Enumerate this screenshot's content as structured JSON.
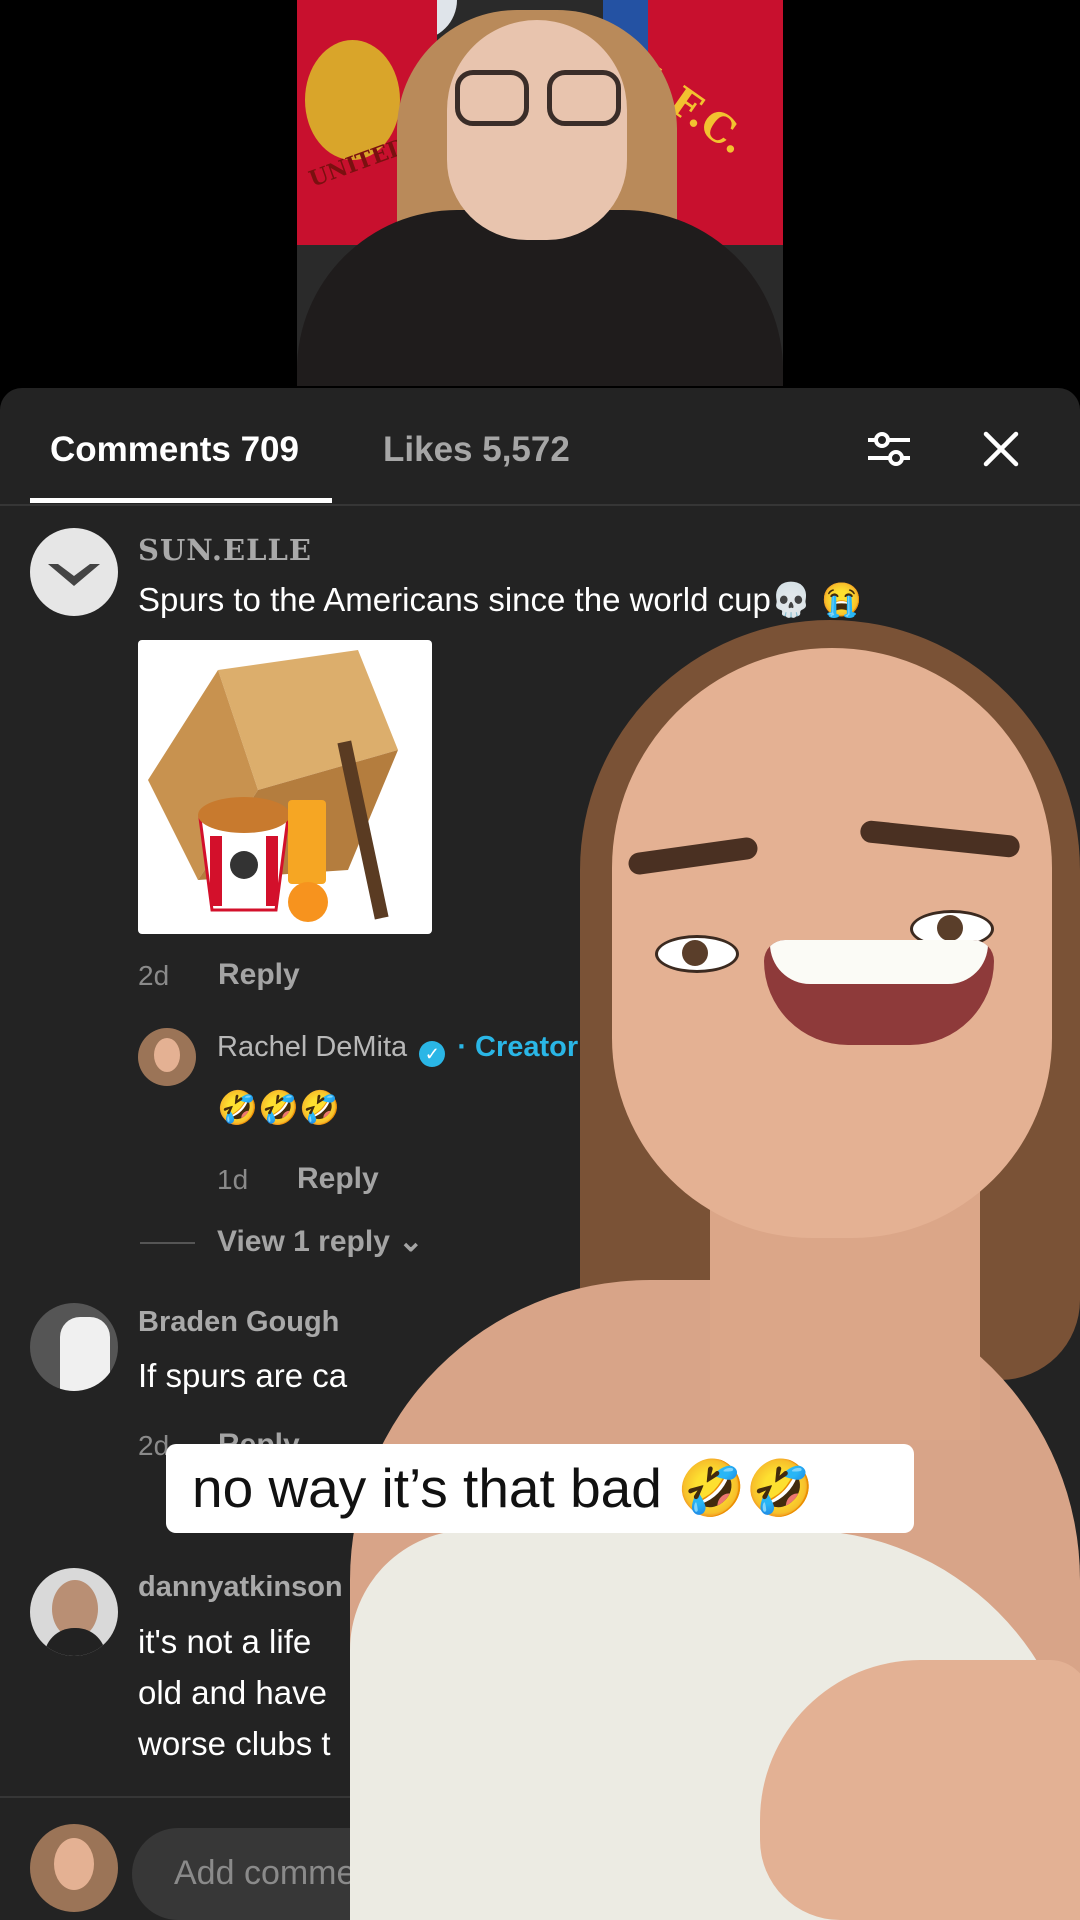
{
  "tabs": {
    "comments_label": "Comments 709",
    "likes_label": "Likes 5,572"
  },
  "icons": {
    "filter": "sliders-icon",
    "close": "close-icon"
  },
  "comments": [
    {
      "username": "SUN.ELLE",
      "text": "Spurs to the Americans since the world cup💀 😭",
      "age": "2d",
      "reply_label": "Reply",
      "image_description": "wooden box trap over fried chicken bucket and orange juice"
    },
    {
      "username": "Braden Gough",
      "text": "If spurs are ca",
      "age": "2d",
      "reply_label": "Reply"
    },
    {
      "username": "dannyatkinson",
      "lines": [
        "it's not a life",
        "old and have",
        "worse clubs t"
      ]
    }
  ],
  "creator_reply": {
    "username": "Rachel DeMita",
    "badge": "· Creator",
    "text": "🤣🤣🤣",
    "age": "1d",
    "reply_label": "Reply"
  },
  "view_replies_label": "View 1 reply ⌄",
  "add_comment_placeholder": "Add comme",
  "caption": "no way it’s that bad 🤣🤣",
  "colors": {
    "panel_bg": "#232323",
    "creator_accent": "#2ab6e6",
    "caption_bg": "#ffffff"
  }
}
